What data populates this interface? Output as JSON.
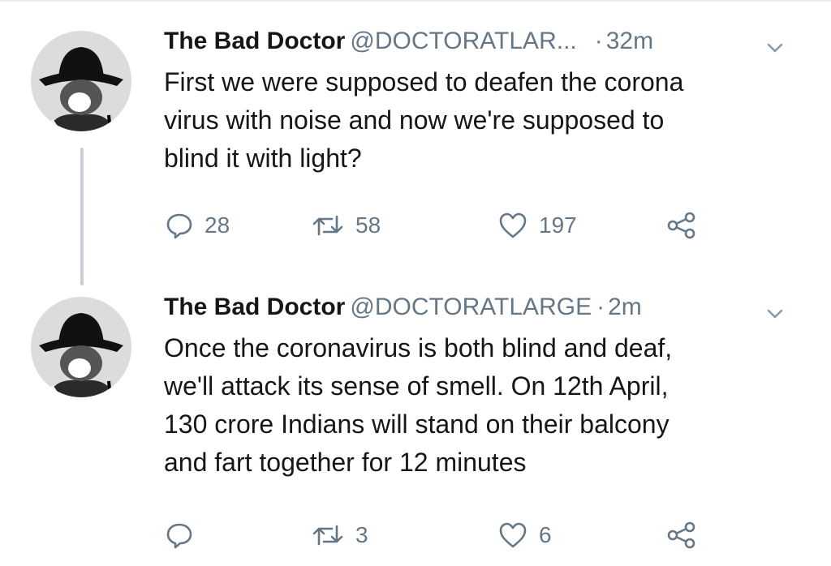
{
  "tweets": [
    {
      "name": "The Bad Doctor",
      "handle": "@DOCTORATLAR...",
      "dot": "·",
      "time": "32m",
      "text": "First we were supposed to deafen the corona\nvirus with noise and now we're supposed to\nblind it with light?",
      "replies": "28",
      "retweets": "58",
      "likes": "197"
    },
    {
      "name": "The Bad Doctor",
      "handle": "@DOCTORATLARGE",
      "dot": "·",
      "time": "2m",
      "text": "Once the coronavirus is both blind and deaf,\nwe'll attack its sense of smell. On 12th April,\n130 crore Indians will stand on their balcony\nand fart together for 12 minutes",
      "replies": "",
      "retweets": "3",
      "likes": "6"
    }
  ],
  "icons": {
    "avatar": "avatar-hat-mask",
    "menu": "chevron-down-icon",
    "reply": "reply-icon",
    "retweet": "retweet-icon",
    "like": "heart-icon",
    "share": "share-icon"
  },
  "colors": {
    "text": "#14171a",
    "muted": "#657786",
    "thread_line": "#c8d0d7",
    "background": "#ffffff"
  }
}
